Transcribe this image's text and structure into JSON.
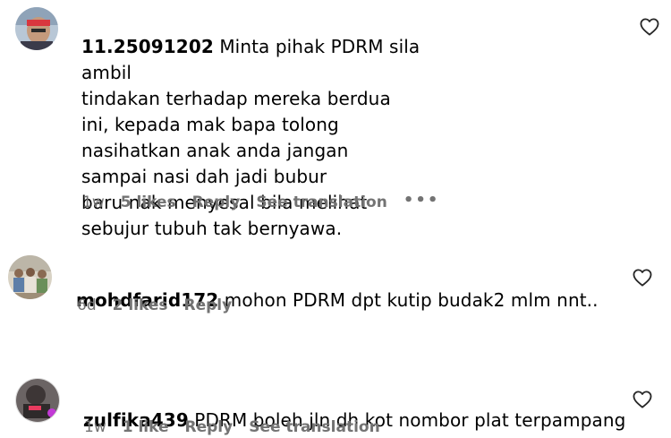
{
  "comments": [
    {
      "username": "11.25091202",
      "text": " Minta pihak PDRM sila ambil\ntindakan terhadap mereka berdua\nini, kepada mak bapa tolong\nnasihatkan anak anda jangan\nsampai nasi dah jadi bubur\nbaru nak menyesal bila melihat\nsebujur tubuh tak bernyawa.",
      "time": "1w",
      "likes": "5 likes",
      "reply": "Reply",
      "translation": "See translation",
      "more": "•••"
    },
    {
      "username": "mohdfarid172",
      "text": " mohon PDRM dpt kutip budak2 mlm nnt..",
      "time": "6d",
      "likes": "2 likes",
      "reply": "Reply"
    },
    {
      "username": "zulfika439",
      "text": " PDRM boleh jln dh kot nombor plat terpampang tu",
      "time": "1w",
      "likes": "1 like",
      "reply": "Reply",
      "translation": "See translation"
    }
  ],
  "icons": {
    "like": "heart-outline-icon",
    "more": "more-options-icon"
  },
  "colors": {
    "text": "#000000",
    "meta": "#737373",
    "background": "#ffffff"
  }
}
